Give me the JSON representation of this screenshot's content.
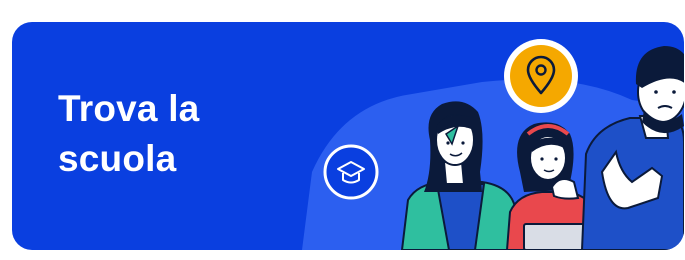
{
  "banner": {
    "title_line1": "Trova la",
    "title_line2": "scuola"
  },
  "colors": {
    "banner_background": "#0a3fe0",
    "title_text": "#ffffff",
    "pin_badge": "#f5a800",
    "teacher_cardigan": "#2fbf9f",
    "girl_sweater": "#e9484d",
    "man_shirt": "#1e50c8"
  },
  "icons": [
    "graduation-cap-icon",
    "map-pin-icon"
  ]
}
